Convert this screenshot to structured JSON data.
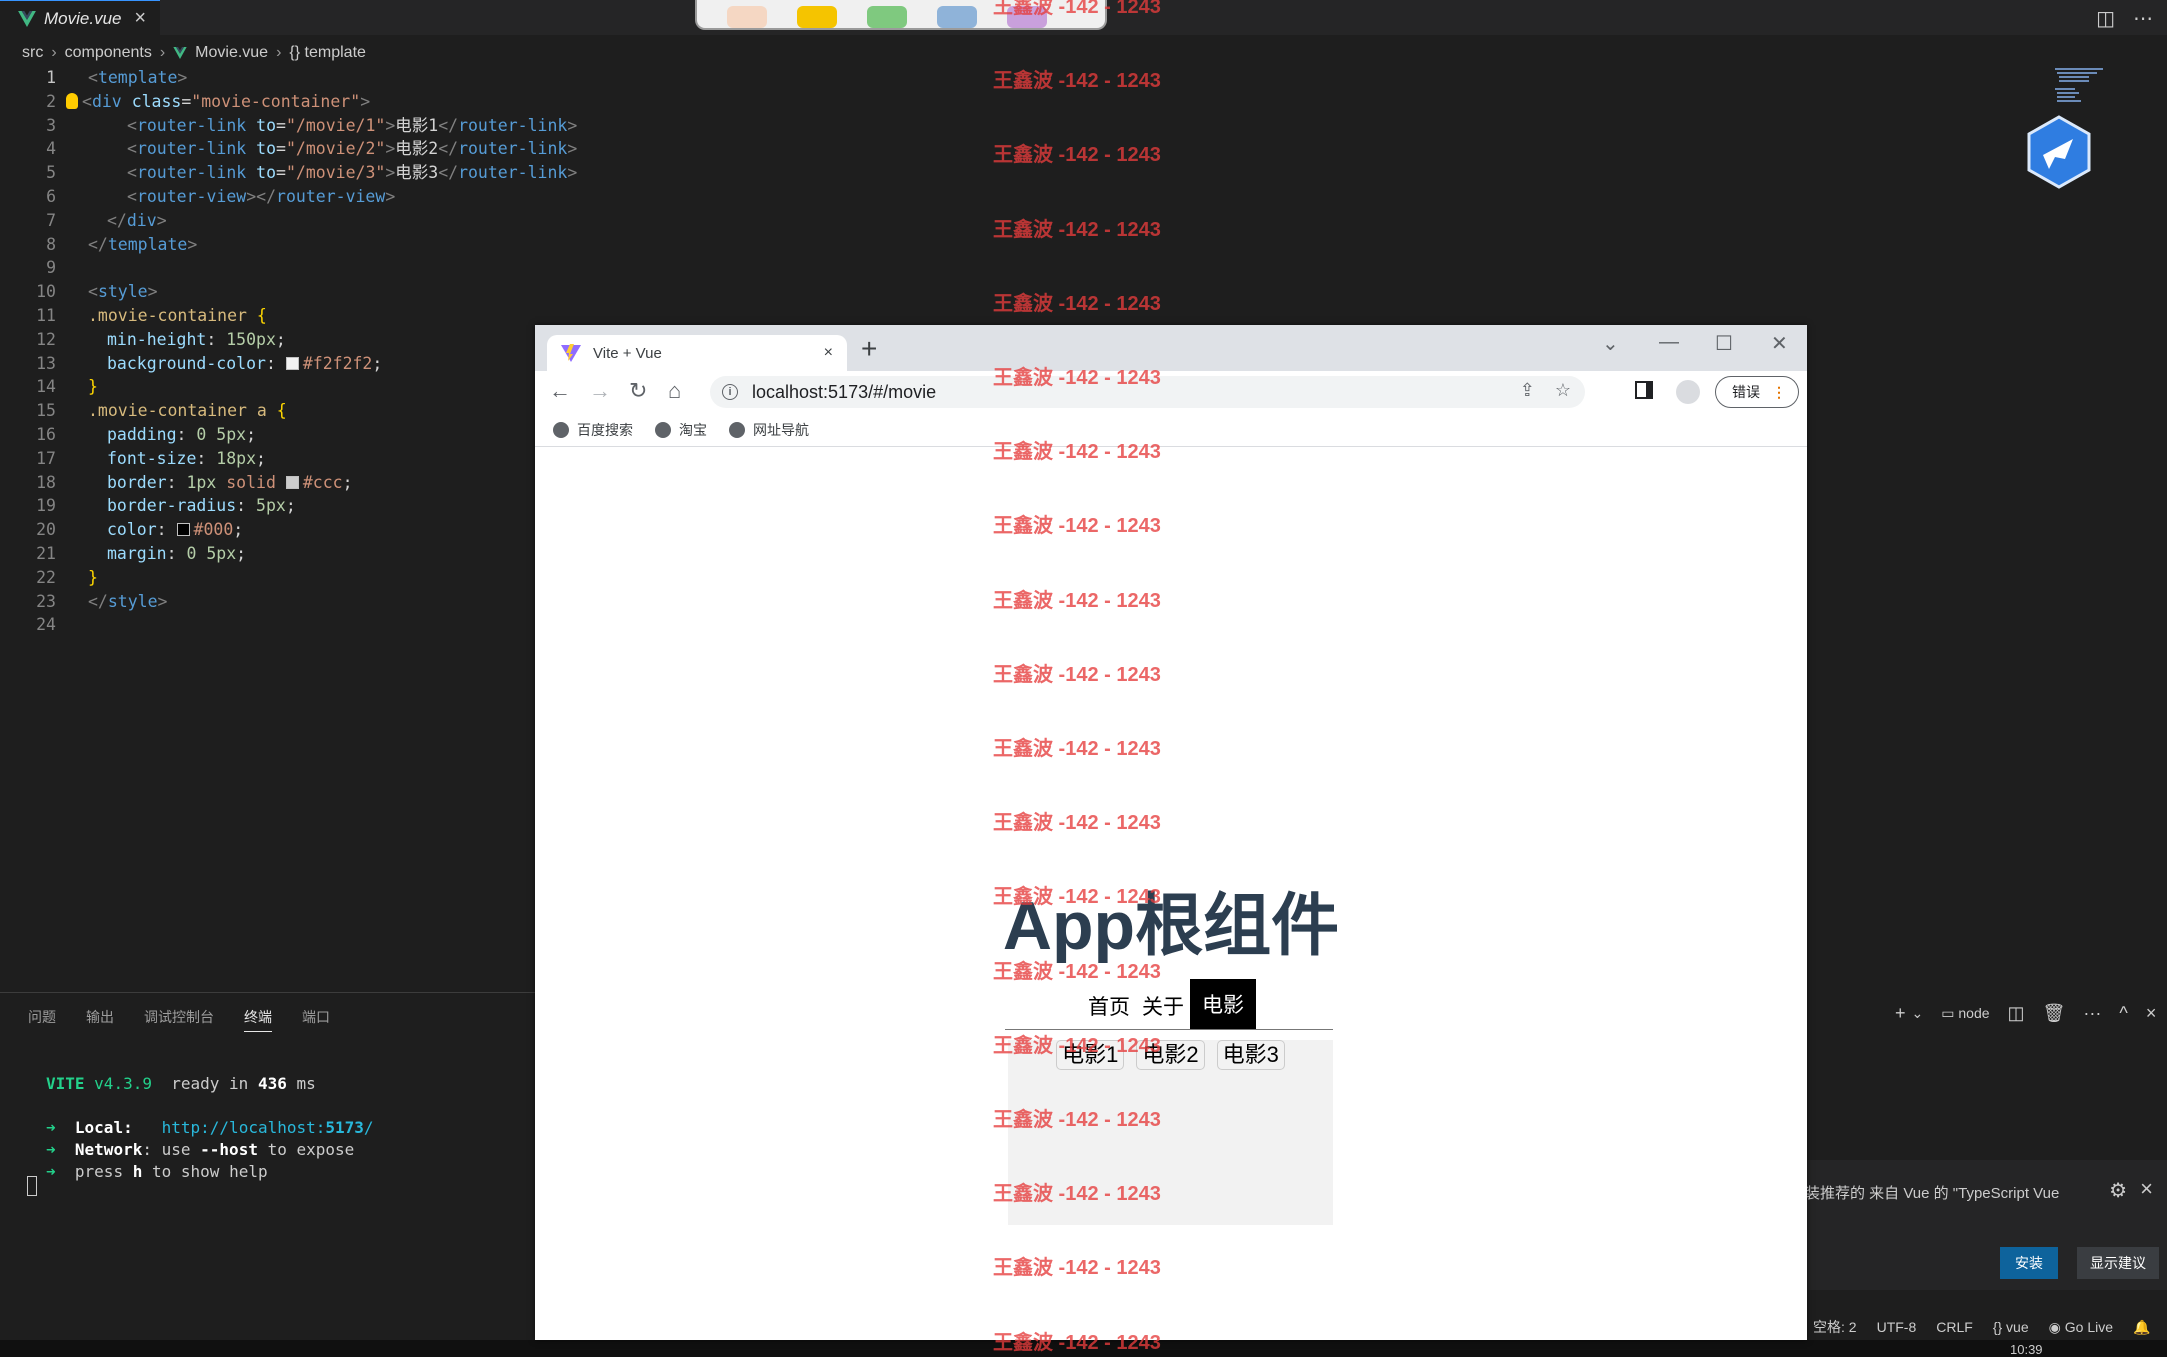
{
  "editor": {
    "tab_label": "Movie.vue",
    "tab_close": "×",
    "breadcrumb": [
      "src",
      "components",
      "Movie.vue",
      "{} template"
    ],
    "lines": [
      {
        "n": "1",
        "indent": 0,
        "parts": [
          [
            "tag-b",
            "<"
          ],
          [
            "tag",
            "template"
          ],
          [
            "tag-b",
            ">"
          ]
        ]
      },
      {
        "n": "2",
        "indent": 0,
        "bulb": true,
        "parts": [
          [
            "tag-b",
            "<"
          ],
          [
            "tag",
            "div"
          ],
          [
            "txt",
            " "
          ],
          [
            "attr",
            "class"
          ],
          [
            "txt",
            "="
          ],
          [
            "str",
            "\"movie-container\""
          ],
          [
            "tag-b",
            ">"
          ]
        ]
      },
      {
        "n": "3",
        "indent": 2,
        "parts": [
          [
            "tag-b",
            "<"
          ],
          [
            "tag",
            "router-link"
          ],
          [
            "txt",
            " "
          ],
          [
            "attr",
            "to"
          ],
          [
            "txt",
            "="
          ],
          [
            "str",
            "\"/movie/1\""
          ],
          [
            "tag-b",
            ">"
          ],
          [
            "txt",
            "电影1"
          ],
          [
            "tag-b",
            "</"
          ],
          [
            "tag",
            "router-link"
          ],
          [
            "tag-b",
            ">"
          ]
        ]
      },
      {
        "n": "4",
        "indent": 2,
        "parts": [
          [
            "tag-b",
            "<"
          ],
          [
            "tag",
            "router-link"
          ],
          [
            "txt",
            " "
          ],
          [
            "attr",
            "to"
          ],
          [
            "txt",
            "="
          ],
          [
            "str",
            "\"/movie/2\""
          ],
          [
            "tag-b",
            ">"
          ],
          [
            "txt",
            "电影2"
          ],
          [
            "tag-b",
            "</"
          ],
          [
            "tag",
            "router-link"
          ],
          [
            "tag-b",
            ">"
          ]
        ]
      },
      {
        "n": "5",
        "indent": 2,
        "parts": [
          [
            "tag-b",
            "<"
          ],
          [
            "tag",
            "router-link"
          ],
          [
            "txt",
            " "
          ],
          [
            "attr",
            "to"
          ],
          [
            "txt",
            "="
          ],
          [
            "str",
            "\"/movie/3\""
          ],
          [
            "tag-b",
            ">"
          ],
          [
            "txt",
            "电影3"
          ],
          [
            "tag-b",
            "</"
          ],
          [
            "tag",
            "router-link"
          ],
          [
            "tag-b",
            ">"
          ]
        ]
      },
      {
        "n": "6",
        "indent": 2,
        "parts": [
          [
            "tag-b",
            "<"
          ],
          [
            "tag",
            "router-view"
          ],
          [
            "tag-b",
            "></"
          ],
          [
            "tag",
            "router-view"
          ],
          [
            "tag-b",
            ">"
          ]
        ]
      },
      {
        "n": "7",
        "indent": 1,
        "parts": [
          [
            "tag-b",
            "</"
          ],
          [
            "tag",
            "div"
          ],
          [
            "tag-b",
            ">"
          ]
        ]
      },
      {
        "n": "8",
        "indent": 0,
        "parts": [
          [
            "tag-b",
            "</"
          ],
          [
            "tag",
            "template"
          ],
          [
            "tag-b",
            ">"
          ]
        ]
      },
      {
        "n": "9",
        "indent": 0,
        "parts": []
      },
      {
        "n": "10",
        "indent": 0,
        "parts": [
          [
            "tag-b",
            "<"
          ],
          [
            "tag",
            "style"
          ],
          [
            "tag-b",
            ">"
          ]
        ]
      },
      {
        "n": "11",
        "indent": 0,
        "parts": [
          [
            "sel",
            ".movie-container"
          ],
          [
            "txt",
            " "
          ],
          [
            "brace",
            "{"
          ]
        ]
      },
      {
        "n": "12",
        "indent": 1,
        "parts": [
          [
            "prop",
            "min-height"
          ],
          [
            "txt",
            ": "
          ],
          [
            "num",
            "150px"
          ],
          [
            "txt",
            ";"
          ]
        ]
      },
      {
        "n": "13",
        "indent": 1,
        "swatch": "#f2f2f2",
        "parts": [
          [
            "prop",
            "background-color"
          ],
          [
            "txt",
            ": "
          ],
          [
            "swatch",
            "#f2f2f2"
          ],
          [
            "val",
            "#f2f2f2"
          ],
          [
            "txt",
            ";"
          ]
        ]
      },
      {
        "n": "14",
        "indent": 0,
        "parts": [
          [
            "brace",
            "}"
          ]
        ]
      },
      {
        "n": "15",
        "indent": 0,
        "parts": [
          [
            "sel",
            ".movie-container a"
          ],
          [
            "txt",
            " "
          ],
          [
            "brace",
            "{"
          ]
        ]
      },
      {
        "n": "16",
        "indent": 1,
        "parts": [
          [
            "prop",
            "padding"
          ],
          [
            "txt",
            ": "
          ],
          [
            "num",
            "0 5px"
          ],
          [
            "txt",
            ";"
          ]
        ]
      },
      {
        "n": "17",
        "indent": 1,
        "parts": [
          [
            "prop",
            "font-size"
          ],
          [
            "txt",
            ": "
          ],
          [
            "num",
            "18px"
          ],
          [
            "txt",
            ";"
          ]
        ]
      },
      {
        "n": "18",
        "indent": 1,
        "parts": [
          [
            "prop",
            "border"
          ],
          [
            "txt",
            ": "
          ],
          [
            "num",
            "1px"
          ],
          [
            "txt",
            " "
          ],
          [
            "val",
            "solid"
          ],
          [
            "txt",
            " "
          ],
          [
            "swatch",
            "#cccccc"
          ],
          [
            "val",
            "#ccc"
          ],
          [
            "txt",
            ";"
          ]
        ]
      },
      {
        "n": "19",
        "indent": 1,
        "parts": [
          [
            "prop",
            "border-radius"
          ],
          [
            "txt",
            ": "
          ],
          [
            "num",
            "5px"
          ],
          [
            "txt",
            ";"
          ]
        ]
      },
      {
        "n": "20",
        "indent": 1,
        "parts": [
          [
            "prop",
            "color"
          ],
          [
            "txt",
            ": "
          ],
          [
            "swatch",
            "#000000"
          ],
          [
            "val",
            "#000"
          ],
          [
            "txt",
            ";"
          ]
        ]
      },
      {
        "n": "21",
        "indent": 1,
        "parts": [
          [
            "prop",
            "margin"
          ],
          [
            "txt",
            ": "
          ],
          [
            "num",
            "0 5px"
          ],
          [
            "txt",
            ";"
          ]
        ]
      },
      {
        "n": "22",
        "indent": 0,
        "parts": [
          [
            "brace",
            "}"
          ]
        ]
      },
      {
        "n": "23",
        "indent": 0,
        "parts": [
          [
            "tag-b",
            "</"
          ],
          [
            "tag",
            "style"
          ],
          [
            "tag-b",
            ">"
          ]
        ]
      },
      {
        "n": "24",
        "indent": 0,
        "parts": []
      }
    ]
  },
  "panel": {
    "tabs": [
      "问题",
      "输出",
      "调试控制台",
      "终端",
      "端口"
    ],
    "active_tab": "终端",
    "right_tools": {
      "add": "+",
      "chevron": "⌄",
      "shell": "node",
      "split": "◫",
      "trash": "🗑",
      "more": "···",
      "up": "^",
      "close": "×"
    }
  },
  "terminal": {
    "vite": "VITE",
    "version": "v4.3.9",
    "ready": "ready in",
    "ms_value": "436",
    "ms": "ms",
    "local_label": "Local",
    "local_url": "http://localhost:",
    "local_port": "5173",
    "network_label": "Network",
    "network_use": "use",
    "network_flag": "--host",
    "network_rest": "to expose",
    "help_press": "press",
    "help_key": "h",
    "help_rest": "to show help",
    "arrow": "➜"
  },
  "notification": {
    "text": "装推荐的 来自 Vue 的 \"TypeScript Vue",
    "install": "安装",
    "show_suggestions": "显示建议"
  },
  "statusbar": [
    "空格: 2",
    "UTF-8",
    "CRLF",
    "{} vue",
    "Go Live"
  ],
  "clock": "10:39",
  "browser": {
    "tab_title": "Vite + Vue",
    "tab_close": "×",
    "new_tab": "+",
    "url": "localhost:5173/#/movie",
    "error_button": "错误",
    "bookmarks": [
      "百度搜索",
      "淘宝",
      "网址导航"
    ]
  },
  "app": {
    "title": "App根组件",
    "nav": [
      {
        "label": "首页",
        "active": false
      },
      {
        "label": "关于",
        "active": false
      },
      {
        "label": "电影",
        "active": true
      }
    ],
    "movies": [
      "电影1",
      "电影2",
      "电影3"
    ]
  },
  "watermark": "王鑫波 -142 - 1243",
  "colors": {
    "editor_bg": "#1e1e1e",
    "accent_blue": "#0e639c",
    "vue_green": "#41b883",
    "watermark_red": "#e63c3c",
    "app_title": "#2c3e50"
  }
}
